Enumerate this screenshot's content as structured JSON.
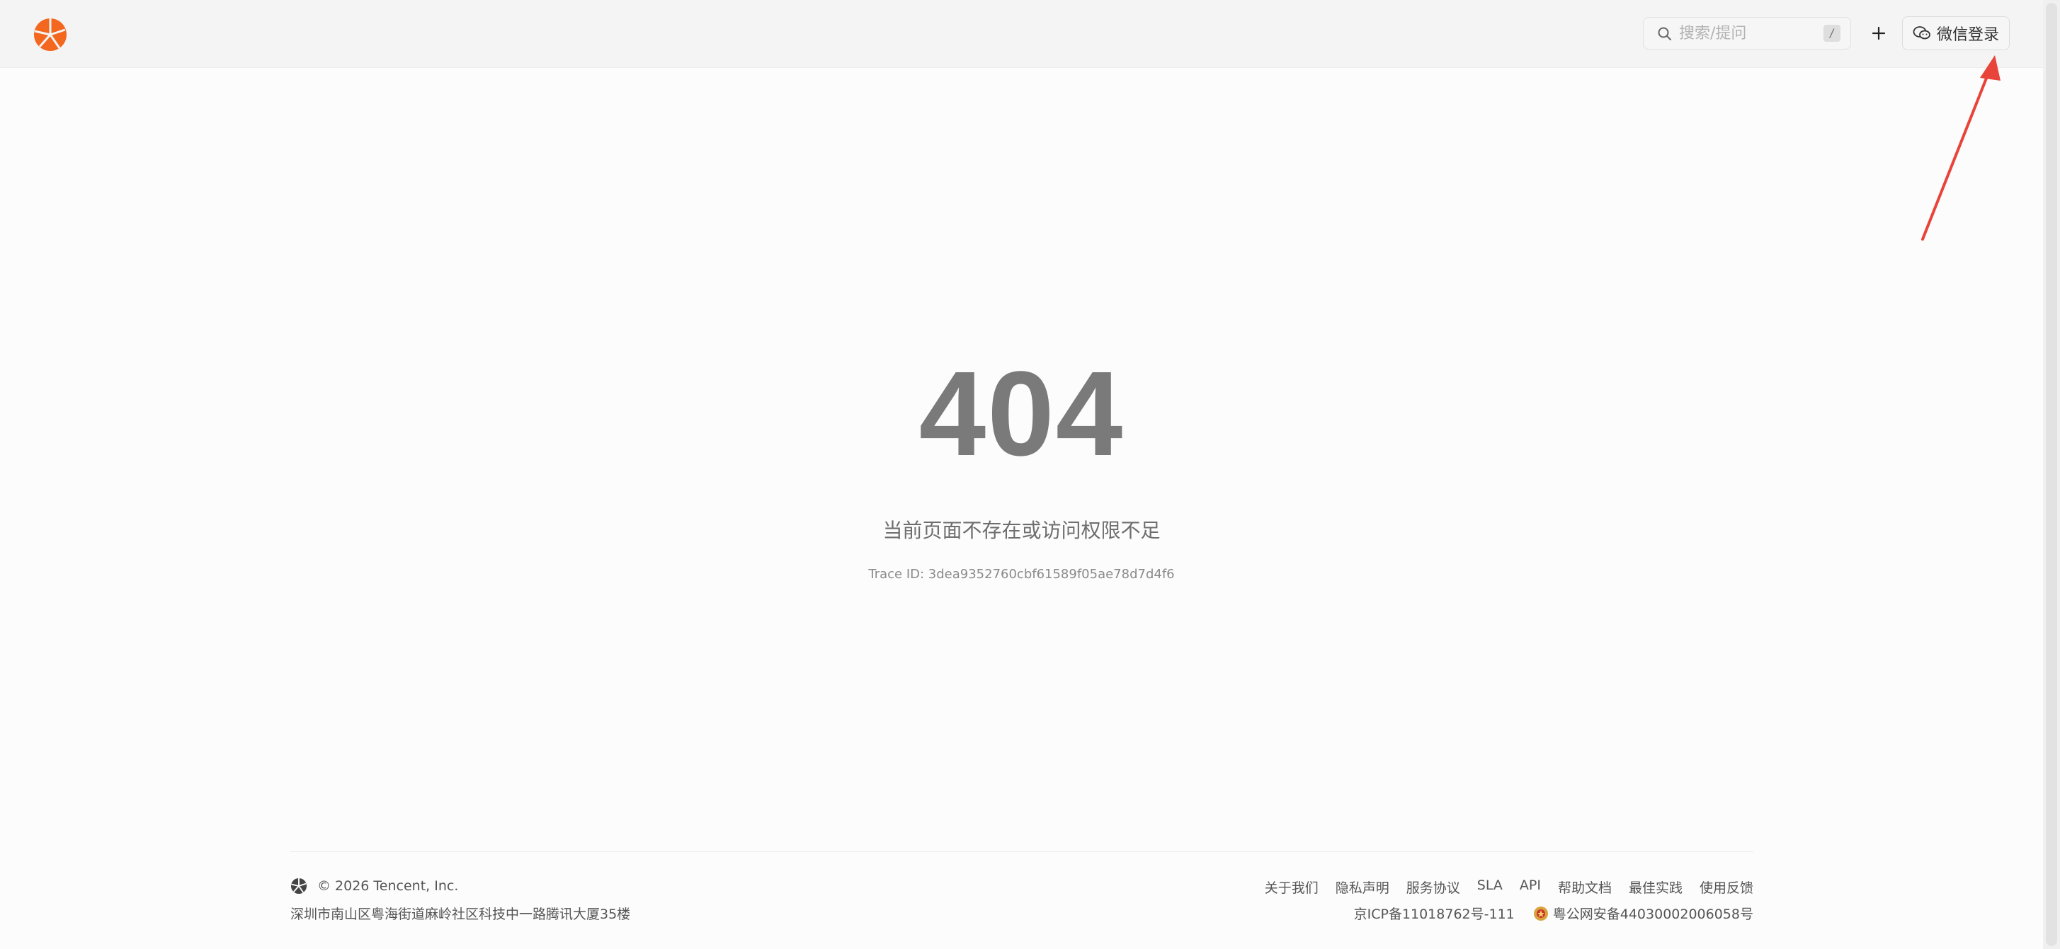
{
  "header": {
    "logo_name": "orange-segmented-logo",
    "search": {
      "placeholder": "搜索/提问",
      "shortcut": "/"
    },
    "plus_label": "+",
    "login_label": "微信登录"
  },
  "main": {
    "error_code": "404",
    "message": "当前页面不存在或访问权限不足",
    "trace_id": "Trace ID: 3dea9352760cbf61589f05ae78d7d4f6"
  },
  "footer": {
    "copyright": "© 2026 Tencent, Inc.",
    "address": "深圳市南山区粤海街道麻岭社区科技中一路腾讯大厦35楼",
    "links": [
      "关于我们",
      "隐私声明",
      "服务协议",
      "SLA",
      "API",
      "帮助文档",
      "最佳实践",
      "使用反馈"
    ],
    "icp": "京ICP备11018762号-111",
    "police": "粤公网安备44030002006058号"
  },
  "colors": {
    "brand_orange": "#f4671f",
    "annotation_red": "#e8443a",
    "error_code_gray": "#7a7a7a"
  }
}
